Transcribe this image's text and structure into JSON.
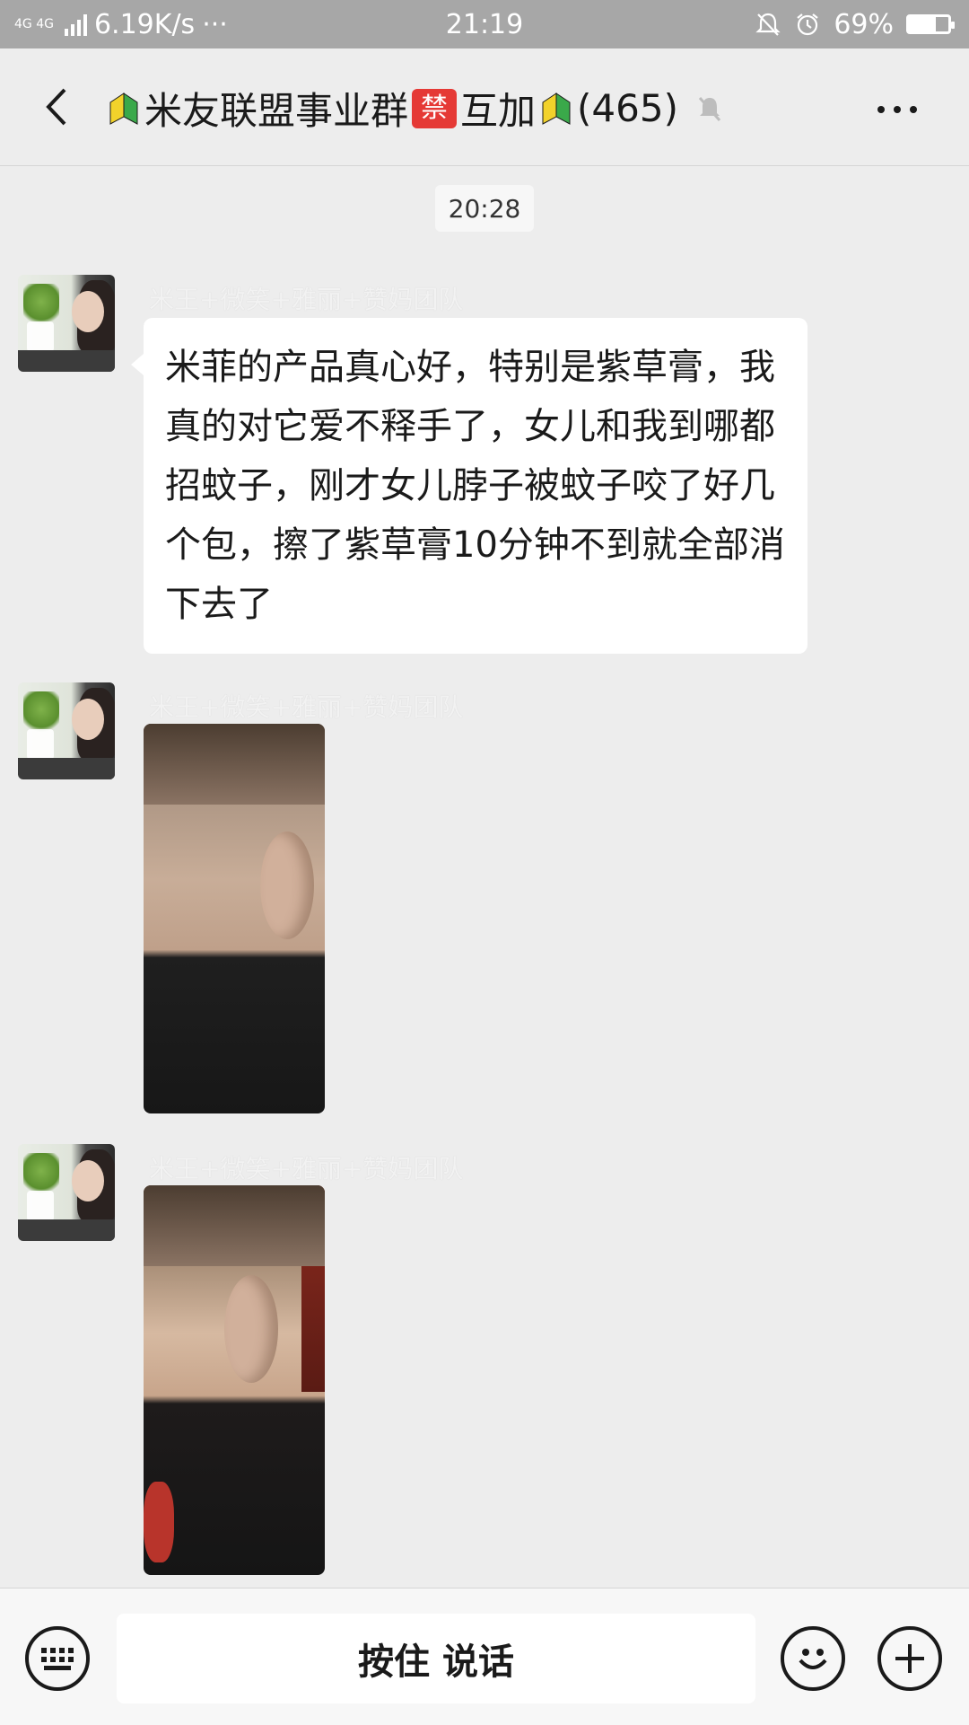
{
  "status_bar": {
    "network": "4G 4G",
    "speed": "6.19K/s",
    "dots": "···",
    "time": "21:19",
    "battery": "69%",
    "battery_level": 0.69,
    "icons": [
      "mute-bell-icon",
      "alarm-icon",
      "battery-icon"
    ]
  },
  "nav": {
    "title_part1": "米友联盟事业群",
    "forbid_badge": "禁",
    "title_part2": "互加",
    "member_count": "(465)",
    "icons": [
      "back-icon",
      "beginner-badge-icon",
      "mute-icon",
      "more-icon"
    ]
  },
  "chat": {
    "timestamp": "20:28",
    "messages": [
      {
        "sender": "米王+微笑+雅丽+赞妈团队",
        "type": "text",
        "text": "米菲的产品真心好，特别是紫草膏，我真的对它爱不释手了，女儿和我到哪都招蚊子，刚才女儿脖子被蚊子咬了好几个包，擦了紫草膏10分钟不到就全部消下去了"
      },
      {
        "sender": "米王+微笑+雅丽+赞妈团队",
        "type": "image"
      },
      {
        "sender": "米王+微笑+雅丽+赞妈团队",
        "type": "image"
      }
    ]
  },
  "input_bar": {
    "hold_to_talk": "按住 说话",
    "icons": [
      "keyboard-icon",
      "emoji-icon",
      "plus-icon"
    ]
  },
  "colors": {
    "background": "#EDEDED",
    "status_bar": "#A7A7A7",
    "bubble": "#FFFFFF",
    "forbid_badge": "#E53935"
  }
}
